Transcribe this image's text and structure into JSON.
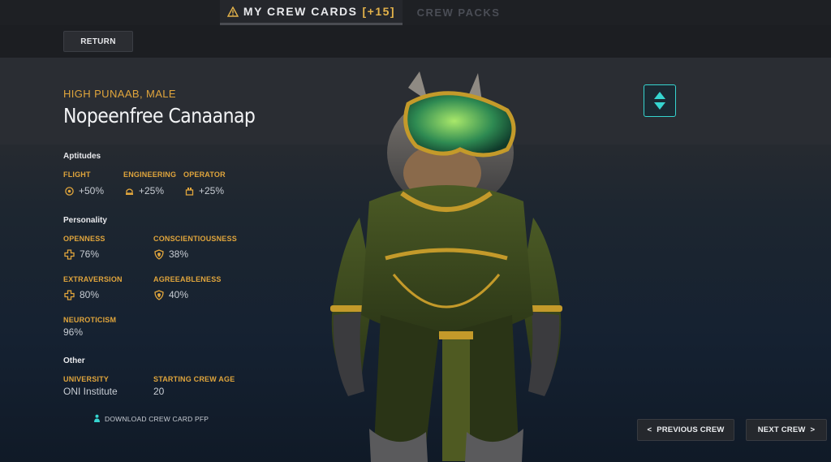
{
  "tabs": {
    "active_label": "MY CREW CARDS",
    "active_badge": "[+15]",
    "inactive_label": "CREW PACKS"
  },
  "toolbar": {
    "return_label": "RETURN"
  },
  "crew": {
    "species": "HIGH PUNAAB, MALE",
    "name": "Nopeenfree Canaanap"
  },
  "aptitudes": {
    "title": "Aptitudes",
    "items": [
      {
        "label": "FLIGHT",
        "value": "+50%",
        "icon": "flight-icon"
      },
      {
        "label": "ENGINEERING",
        "value": "+25%",
        "icon": "engineering-icon"
      },
      {
        "label": "OPERATOR",
        "value": "+25%",
        "icon": "operator-icon"
      }
    ]
  },
  "personality": {
    "title": "Personality",
    "openness": {
      "label": "OPENNESS",
      "value": "76%",
      "icon": "plus-cross-icon"
    },
    "conscientiousness": {
      "label": "CONSCIENTIOUSNESS",
      "value": "38%",
      "icon": "shield-icon"
    },
    "extraversion": {
      "label": "EXTRAVERSION",
      "value": "80%",
      "icon": "plus-cross-icon"
    },
    "agreeableness": {
      "label": "AGREEABLENESS",
      "value": "40%",
      "icon": "shield-icon"
    },
    "neuroticism": {
      "label": "NEUROTICISM",
      "value": "96%"
    }
  },
  "other": {
    "title": "Other",
    "university": {
      "label": "UNIVERSITY",
      "value": "ONI Institute"
    },
    "starting_age": {
      "label": "STARTING CREW AGE",
      "value": "20"
    }
  },
  "download": {
    "label": "DOWNLOAD CREW CARD PFP",
    "icon": "download-person-icon"
  },
  "nav": {
    "previous_label": "PREVIOUS CREW",
    "previous_arrow": "<",
    "next_label": "NEXT CREW",
    "next_arrow": ">"
  },
  "colors": {
    "accent_gold": "#e0a53c",
    "accent_cyan": "#36d5d0",
    "background_dark": "#1c1e22"
  }
}
